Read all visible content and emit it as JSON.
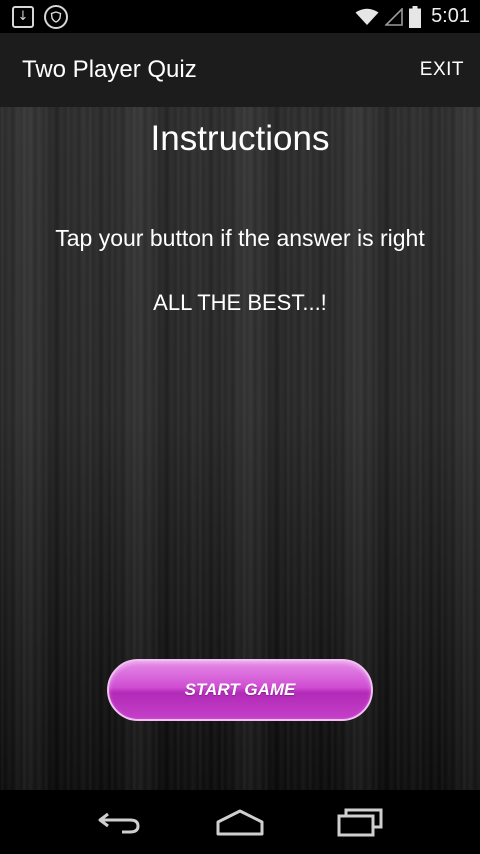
{
  "status_bar": {
    "time": "5:01",
    "icons": [
      "download-notification-icon",
      "shield-notification-icon",
      "wifi-icon",
      "cell-signal-icon",
      "battery-icon"
    ]
  },
  "action_bar": {
    "title": "Two Player Quiz",
    "exit_label": "EXIT"
  },
  "main": {
    "heading": "Instructions",
    "instruction": "Tap your button if the answer is right",
    "wish": "ALL THE BEST...!",
    "start_label": "START GAME"
  },
  "nav_bar": {
    "icons": [
      "back-icon",
      "home-icon",
      "recent-apps-icon"
    ]
  },
  "colors": {
    "button_top": "#e58be6",
    "button_bottom": "#b22ab8",
    "action_bar": "#1c1c1c"
  }
}
